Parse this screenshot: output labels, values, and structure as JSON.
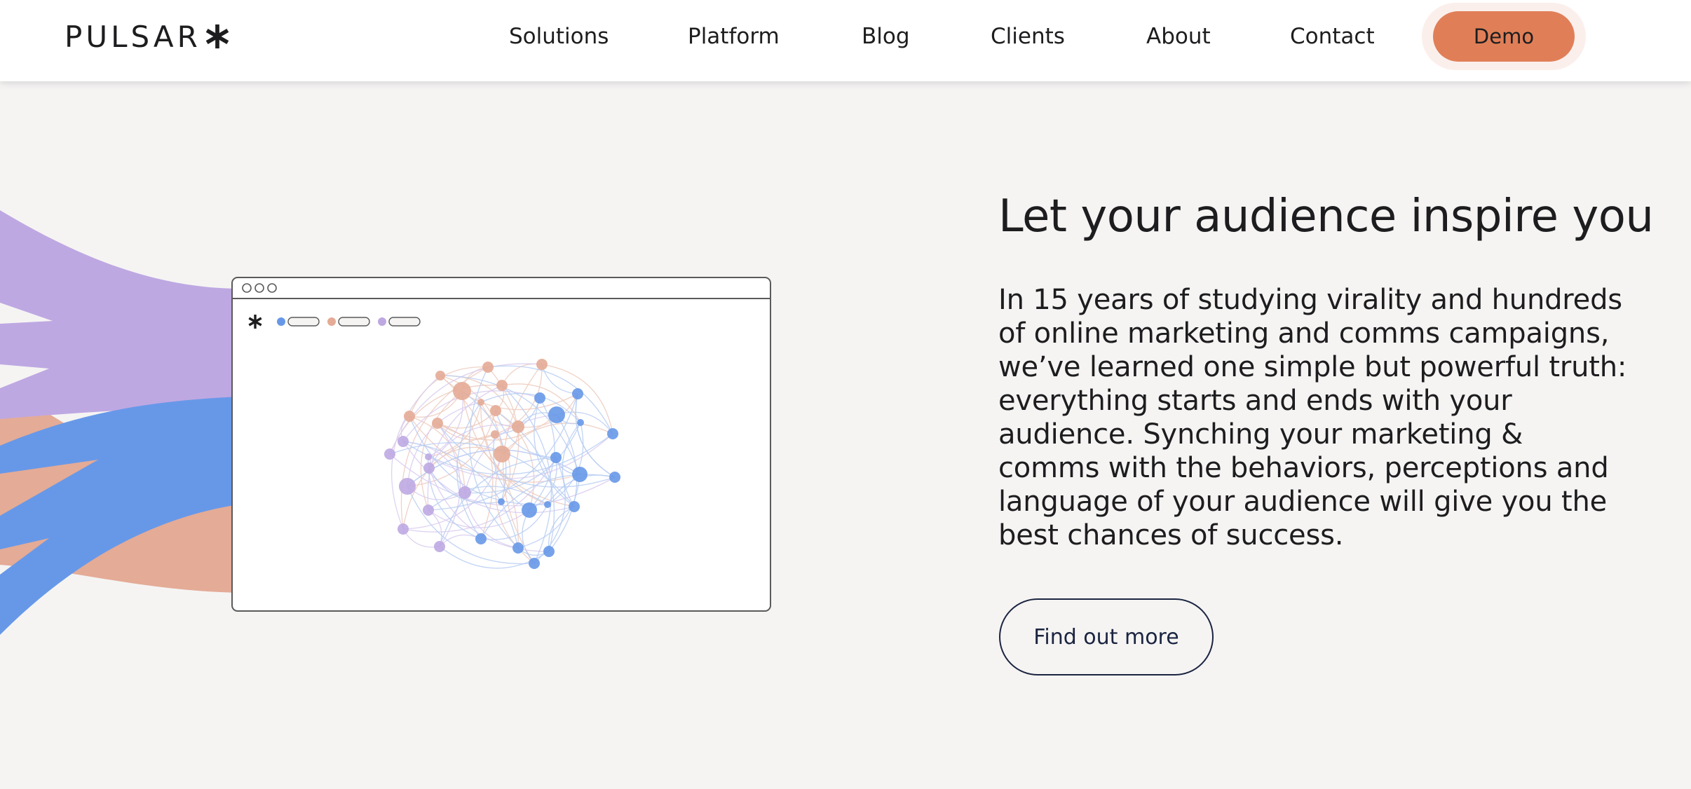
{
  "header": {
    "logo_text": "PULSAR",
    "logo_mark": "asterisk-icon",
    "nav": [
      {
        "label": "Solutions"
      },
      {
        "label": "Platform"
      },
      {
        "label": "Blog"
      },
      {
        "label": "Clients"
      },
      {
        "label": "About"
      },
      {
        "label": "Contact"
      }
    ],
    "demo_label": "Demo"
  },
  "hero": {
    "headline": "Let your audience inspire you",
    "body": "In 15 years of studying virality and hundreds of online marketing and comms campaigns, we’ve learned one simple but powerful truth: everything starts and ends with your audience. Synching your marketing & comms with the behaviors, perceptions and language of your audience will give you the best chances of success.",
    "cta_label": "Find out more"
  },
  "illustration": {
    "icons": [
      "window-dots-icon",
      "asterisk-icon",
      "network-graph"
    ],
    "colors": {
      "purple": "#bea8e2",
      "blue": "#6798e8",
      "salmon": "#e4ab96",
      "accent": "#e07f57",
      "ink": "#1d1d1f"
    }
  }
}
